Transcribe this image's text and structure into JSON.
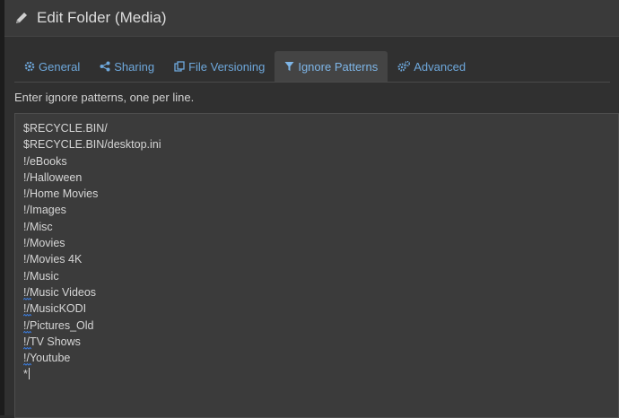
{
  "header": {
    "title": "Edit Folder (Media)",
    "icon": "pencil-icon"
  },
  "tabs": [
    {
      "label": "General",
      "icon": "gear-icon",
      "active": false
    },
    {
      "label": "Sharing",
      "icon": "share-icon",
      "active": false
    },
    {
      "label": "File Versioning",
      "icon": "copy-icon",
      "active": false
    },
    {
      "label": "Ignore Patterns",
      "icon": "filter-icon",
      "active": true
    },
    {
      "label": "Advanced",
      "icon": "gears-icon",
      "active": false
    }
  ],
  "instructions": "Enter ignore patterns, one per line.",
  "patterns": [
    "$RECYCLE.BIN/",
    "$RECYCLE.BIN/desktop.ini",
    "!/eBooks",
    "!/Halloween",
    "!/Home Movies",
    "!/Images",
    "!/Misc",
    "!/Movies",
    "!/Movies 4K",
    "!/Music",
    "!/Music Videos",
    "!/MusicKODI",
    "!/Pictures_Old",
    "!/TV Shows",
    "!/Youtube",
    "*"
  ],
  "colors": {
    "link": "#6ea8dc",
    "active_tab_bg": "#444444",
    "spellcheck": "#3b7bdc"
  }
}
